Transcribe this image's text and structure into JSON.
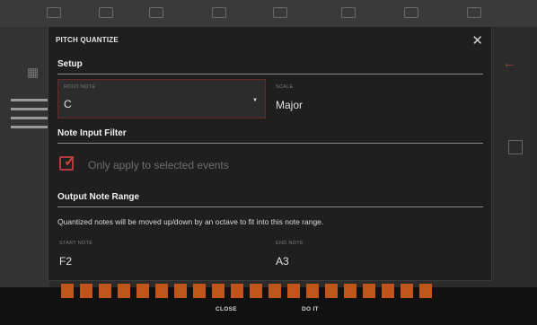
{
  "dialog": {
    "title": "PITCH QUANTIZE",
    "close_icon": "close-icon"
  },
  "setup": {
    "heading": "Setup",
    "root_note": {
      "label": "ROOT NOTE",
      "value": "C"
    },
    "scale": {
      "label": "SCALE",
      "value": "Major"
    }
  },
  "note_input_filter": {
    "heading": "Note Input Filter",
    "checkbox_label": "Only apply to selected events",
    "checked": true
  },
  "output_note_range": {
    "heading": "Output Note Range",
    "description": "Quantized notes will be moved up/down by an octave to fit into this note range.",
    "start_note": {
      "label": "START NOTE",
      "value": "F2"
    },
    "end_note": {
      "label": "END NOTE",
      "value": "A3"
    }
  },
  "footer": {
    "close_label": "CLOSE",
    "do_it_label": "DO IT"
  },
  "colors": {
    "accent": "#c0392b",
    "dialog_bg": "#1f1f1f"
  }
}
